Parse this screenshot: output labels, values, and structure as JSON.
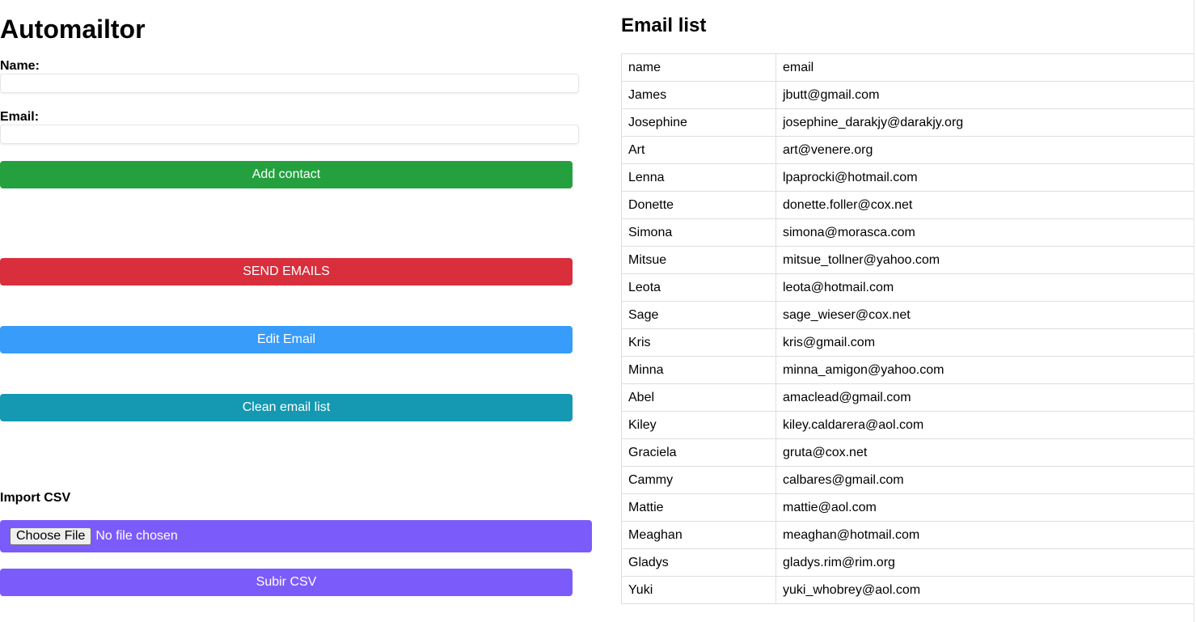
{
  "app": {
    "title": "Automailtor"
  },
  "form": {
    "name_label": "Name:",
    "name_value": "",
    "email_label": "Email:",
    "email_value": "",
    "add_button": "Add contact"
  },
  "actions": {
    "send_button": "SEND EMAILS",
    "edit_button": "Edit Email",
    "clean_button": "Clean email list"
  },
  "csv": {
    "label": "Import CSV",
    "choose_button": "Choose File",
    "file_status": "No file chosen",
    "upload_button": "Subir CSV"
  },
  "colors": {
    "add": "#24a03f",
    "send": "#d92e3c",
    "edit": "#379cfa",
    "clean": "#1598b1",
    "csv": "#7b5cfa"
  },
  "list": {
    "title": "Email list",
    "header": {
      "name": "name",
      "email": "email"
    },
    "rows": [
      {
        "name": "James",
        "email": "jbutt@gmail.com"
      },
      {
        "name": "Josephine",
        "email": "josephine_darakjy@darakjy.org"
      },
      {
        "name": "Art",
        "email": "art@venere.org"
      },
      {
        "name": "Lenna",
        "email": "lpaprocki@hotmail.com"
      },
      {
        "name": "Donette",
        "email": "donette.foller@cox.net"
      },
      {
        "name": "Simona",
        "email": "simona@morasca.com"
      },
      {
        "name": "Mitsue",
        "email": "mitsue_tollner@yahoo.com"
      },
      {
        "name": "Leota",
        "email": "leota@hotmail.com"
      },
      {
        "name": "Sage",
        "email": "sage_wieser@cox.net"
      },
      {
        "name": "Kris",
        "email": "kris@gmail.com"
      },
      {
        "name": "Minna",
        "email": "minna_amigon@yahoo.com"
      },
      {
        "name": "Abel",
        "email": "amaclead@gmail.com"
      },
      {
        "name": "Kiley",
        "email": "kiley.caldarera@aol.com"
      },
      {
        "name": "Graciela",
        "email": "gruta@cox.net"
      },
      {
        "name": "Cammy",
        "email": "calbares@gmail.com"
      },
      {
        "name": "Mattie",
        "email": "mattie@aol.com"
      },
      {
        "name": "Meaghan",
        "email": "meaghan@hotmail.com"
      },
      {
        "name": "Gladys",
        "email": "gladys.rim@rim.org"
      },
      {
        "name": "Yuki",
        "email": "yuki_whobrey@aol.com"
      }
    ]
  }
}
